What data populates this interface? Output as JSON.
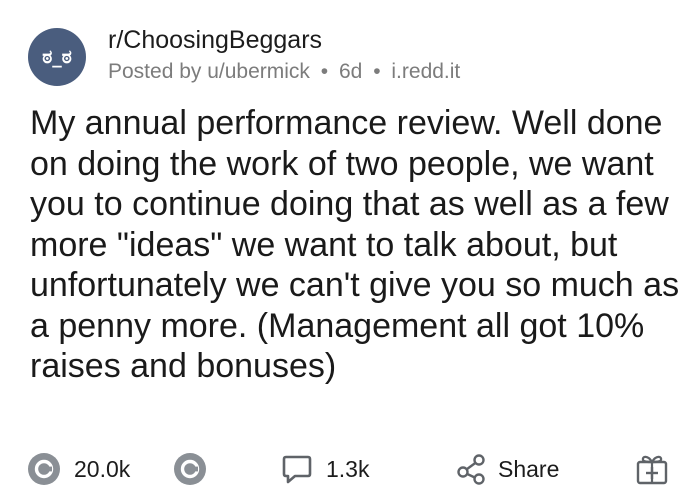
{
  "post": {
    "subreddit": "r/ChoosingBeggars",
    "avatar_text": "ಠ_ಠ",
    "posted_by": "Posted by u/ubermick",
    "age": "6d",
    "domain": "i.redd.it",
    "meta_separator": "•",
    "title": "My annual performance review. Well done on doing the work of two people, we want you to continue doing that as well as a few more \"ideas\" we want to talk about, but unfortunately we can't give you so much as a penny more. (Management all got 10% raises and bonuses)"
  },
  "actions": {
    "upvote_count": "20.0k",
    "comment_count": "1.3k",
    "share_label": "Share"
  },
  "icons": {
    "upvote": "upvote-icon",
    "downvote": "downvote-icon",
    "comment": "comment-icon",
    "share": "share-icon",
    "award": "award-gift-icon"
  },
  "colors": {
    "avatar_bg": "#4a5d7e",
    "meta_text": "#7c7c7c",
    "icon_gray": "#5f6368"
  }
}
